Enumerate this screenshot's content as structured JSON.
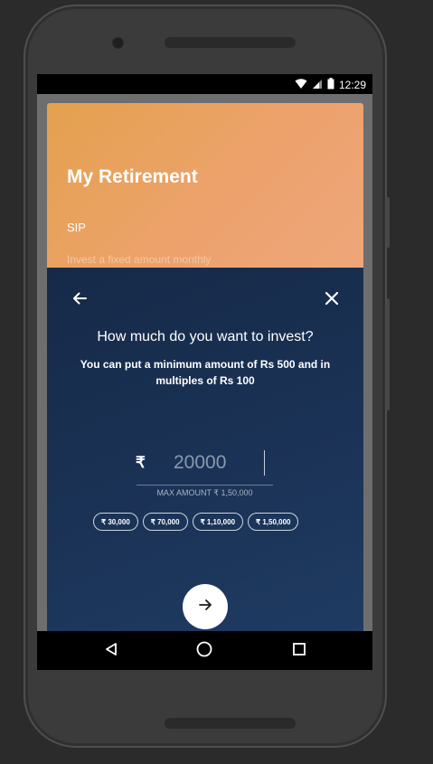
{
  "status_bar": {
    "time": "12:29",
    "icons": [
      "wifi-icon",
      "signal-icon",
      "battery-icon"
    ]
  },
  "header": {
    "title": "My Retirement",
    "subtitle": "SIP",
    "hint": "Invest a fixed amount monthly"
  },
  "sheet": {
    "question": "How much do you want to invest?",
    "description": "You can put a minimum amount of Rs 500 and in multiples of Rs 100",
    "currency_symbol": "₹",
    "amount_value": "20000",
    "max_amount_label": "MAX AMOUNT ₹ 1,50,000",
    "quick_amounts": [
      "₹ 30,000",
      "₹ 70,000",
      "₹ 1,10,000",
      "₹ 1,50,000"
    ],
    "icons": {
      "back": "arrow-left-icon",
      "close": "close-icon",
      "next": "arrow-right-icon"
    }
  },
  "nav_bar": {
    "icons": [
      "back-triangle-icon",
      "home-circle-icon",
      "recents-square-icon"
    ]
  },
  "colors": {
    "header_gradient_start": "#e4a14e",
    "header_gradient_end": "#eea77b",
    "sheet_background": "#1b3357",
    "accent_white": "#ffffff"
  }
}
